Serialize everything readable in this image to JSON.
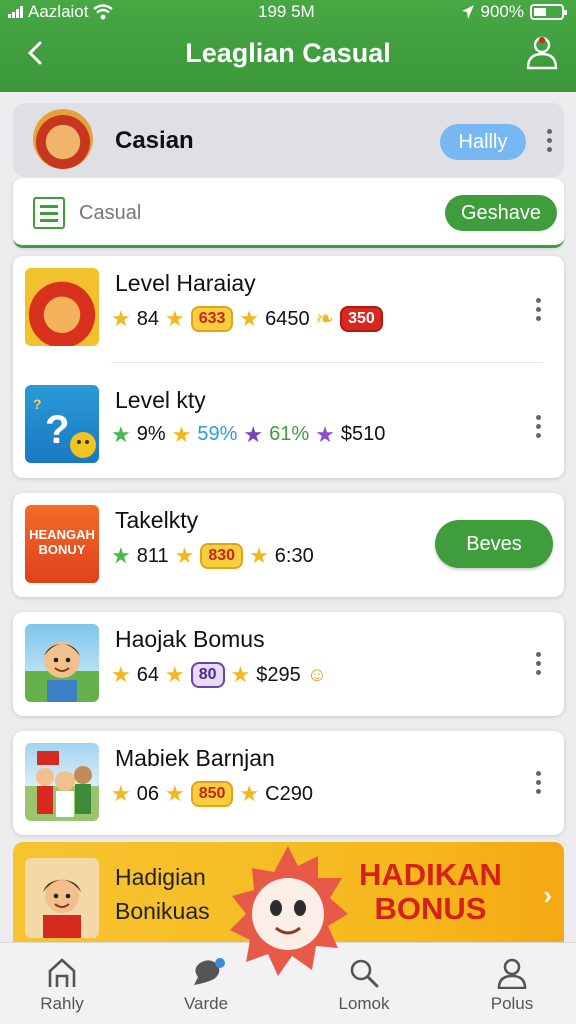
{
  "status_bar": {
    "carrier": "Aazlaiot",
    "time": "199 5M",
    "battery": "900%"
  },
  "header": {
    "title": "Leaglian Casual"
  },
  "featured": {
    "name": "Casian",
    "badge": "Hallly"
  },
  "search": {
    "placeholder": "Casual",
    "button": "Geshave"
  },
  "games": [
    {
      "name": "Level Haraiay",
      "stat1": "84",
      "chip1": "633",
      "stat2": "6450",
      "chip2": "350"
    },
    {
      "name": "Level kty",
      "stat1": "9%",
      "stat2": "59%",
      "stat3": "61%",
      "stat4": "$510"
    },
    {
      "name": "Takelkty",
      "stat1": "811",
      "chip1": "830",
      "stat2": "6:30",
      "button": "Beves",
      "thumb_text": "HEANGAH BONUY"
    },
    {
      "name": "Haojak Bomus",
      "stat1": "64",
      "chip1": "80",
      "stat2": "$295"
    },
    {
      "name": "Mabiek Barnjan",
      "stat1": "06",
      "chip1": "850",
      "stat2": "C290"
    }
  ],
  "banner": {
    "line1": "Hadigian",
    "line2": "Bonikuas",
    "promo1": "HADIKAN",
    "promo2": "BONUS"
  },
  "bottom_nav": [
    {
      "label": "Rahly",
      "icon": "home-icon"
    },
    {
      "label": "Varde",
      "icon": "chat-icon"
    },
    {
      "label": "Lomok",
      "icon": "search-icon"
    },
    {
      "label": "Polus",
      "icon": "user-icon"
    }
  ],
  "colors": {
    "primary_green": "#3f9d3c",
    "accent_blue": "#77b7f2",
    "promo_red": "#d6201a",
    "banner_yellow": "#f7c431"
  }
}
